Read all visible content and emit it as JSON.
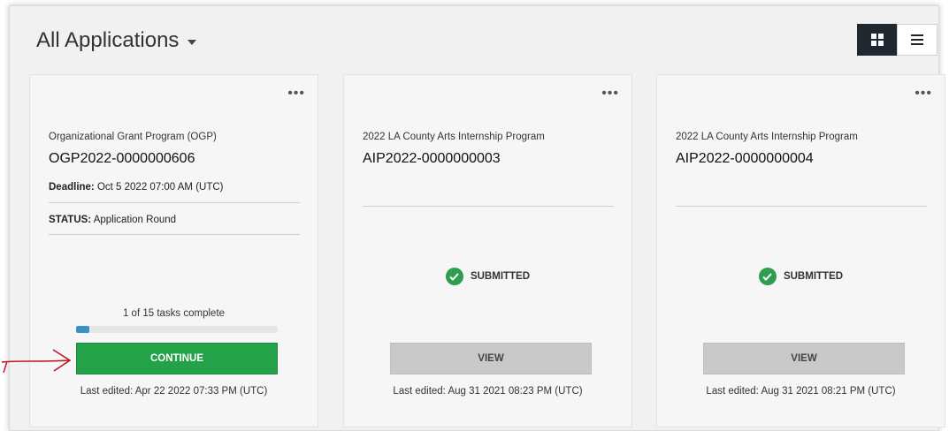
{
  "header": {
    "title": "All Applications",
    "view_toggle": [
      {
        "icon": "grid-icon",
        "active": true
      },
      {
        "icon": "list-icon",
        "active": false
      }
    ]
  },
  "cards": [
    {
      "program": "Organizational Grant Program (OGP)",
      "app_id": "OGP2022-0000000606",
      "deadline_label": "Deadline:",
      "deadline_value": "Oct 5 2022 07:00 AM (UTC)",
      "status_label": "STATUS:",
      "status_value": "Application Round",
      "tasks": "1 of 15 tasks complete",
      "progress": 0.0667,
      "button": "CONTINUE",
      "last_edited": "Last edited: Apr 22 2022 07:33 PM (UTC)"
    },
    {
      "program": "2022 LA County Arts Internship Program",
      "app_id": "AIP2022-0000000003",
      "status": "SUBMITTED",
      "button": "VIEW",
      "last_edited": "Last edited: Aug 31 2021 08:23 PM (UTC)"
    },
    {
      "program": "2022 LA County Arts Internship Program",
      "app_id": "AIP2022-0000000004",
      "status": "SUBMITTED",
      "button": "VIEW",
      "last_edited": "Last edited: Aug 31 2021 08:21 PM (UTC)"
    }
  ],
  "colors": {
    "continue_button": "#24a24a",
    "view_button": "#c9c9c9",
    "progress_fill": "#3b90c8",
    "submitted_check": "#2e9d4e",
    "annotation_arrow": "#c0141c"
  },
  "icons": {
    "more": "more-options-icon",
    "submitted": "check-circle-icon"
  }
}
